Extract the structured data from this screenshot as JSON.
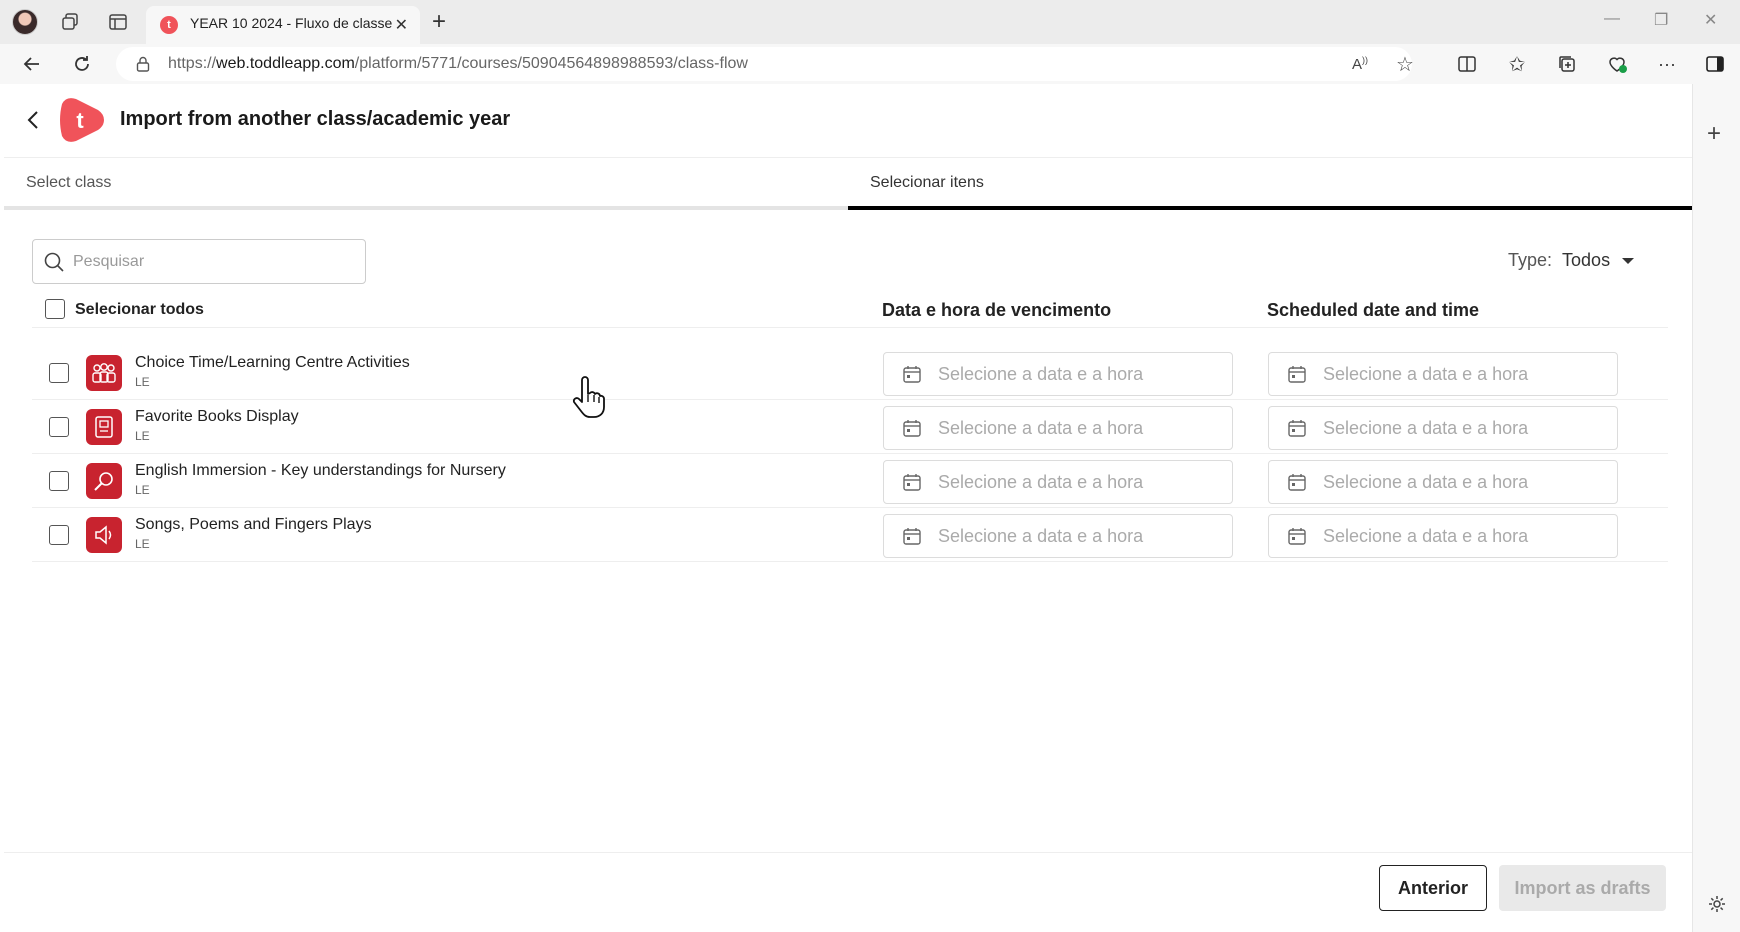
{
  "browser": {
    "tab_title": "YEAR 10 2024 - Fluxo de classe",
    "tab_favicon_letter": "t",
    "url_prefix": "https://",
    "url_host": "web.toddleapp.com",
    "url_path": "/platform/5771/courses/50904564898988593/class-flow"
  },
  "header": {
    "logo_letter": "t",
    "title": "Import from another class/academic year",
    "brand_color": "#f0535a"
  },
  "steps": [
    {
      "label": "Select class",
      "active": false
    },
    {
      "label": "Selecionar itens",
      "active": true
    }
  ],
  "search": {
    "placeholder": "Pesquisar",
    "value": ""
  },
  "type_filter": {
    "label": "Type:",
    "value": "Todos"
  },
  "table": {
    "select_all_label": "Selecionar todos",
    "columns": [
      "Data e hora de vencimento",
      "Scheduled date and time"
    ],
    "date_placeholder": "Selecione a data e a hora",
    "rows": [
      {
        "title": "Choice Time/Learning Centre Activities",
        "subtitle": "LE",
        "icon": "group-people-icon"
      },
      {
        "title": "Favorite Books Display",
        "subtitle": "LE",
        "icon": "book-icon"
      },
      {
        "title": "English Immersion - Key understandings for Nursery",
        "subtitle": "LE",
        "icon": "magnifier-icon"
      },
      {
        "title": "Songs, Poems and Fingers Plays",
        "subtitle": "LE",
        "icon": "speaker-icon"
      }
    ]
  },
  "footer": {
    "previous_label": "Anterior",
    "import_label": "Import as drafts"
  }
}
